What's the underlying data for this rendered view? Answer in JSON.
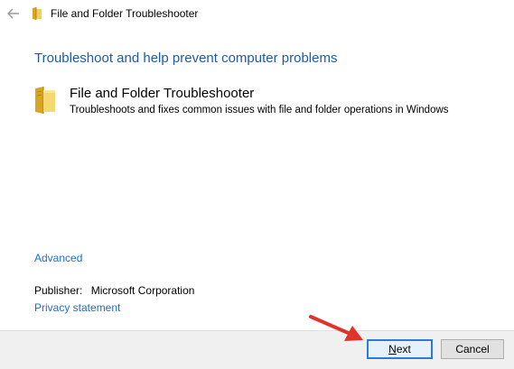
{
  "window": {
    "title": "File and Folder Troubleshooter"
  },
  "main": {
    "headline": "Troubleshoot and help prevent computer problems",
    "troubleshooter": {
      "title": "File and Folder Troubleshooter",
      "description": "Troubleshoots and fixes common issues with file and folder operations in Windows",
      "icon": "folder-icon"
    },
    "advanced_link": "Advanced",
    "publisher_label": "Publisher:",
    "publisher_value": "Microsoft Corporation",
    "privacy_link": "Privacy statement"
  },
  "footer": {
    "next_label": "Next",
    "next_label_first": "N",
    "next_label_rest": "ext",
    "cancel_label": "Cancel"
  },
  "colors": {
    "headline": "#1e5aa8",
    "link": "#1e6ec8",
    "focus_border": "#2c7bd6",
    "arrow": "#e0332b"
  }
}
